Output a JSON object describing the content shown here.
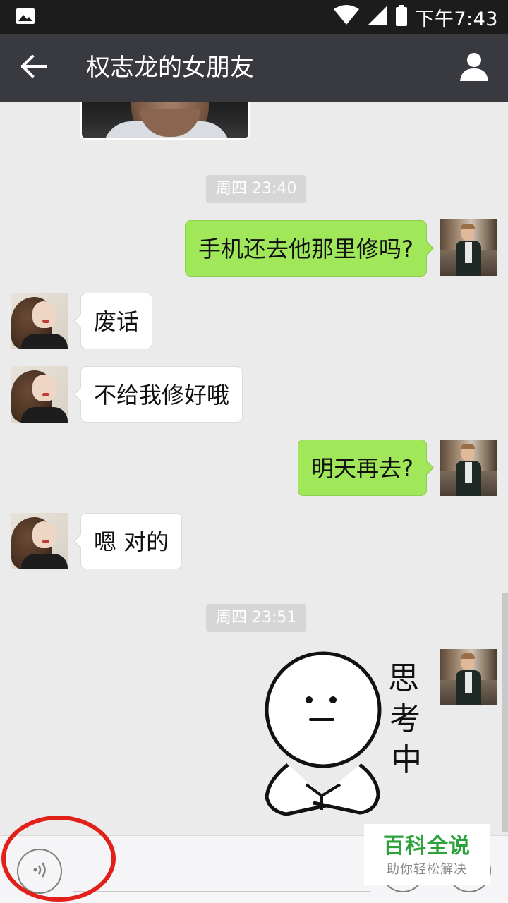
{
  "status_bar": {
    "time": "下午7:43",
    "left_icon": "image-icon",
    "right_icons": [
      "wifi-icon",
      "signal-icon",
      "battery-icon"
    ]
  },
  "header": {
    "title": "权志龙的女朋友",
    "back_icon": "back-arrow-icon",
    "profile_icon": "person-icon"
  },
  "messages": [
    {
      "type": "image",
      "from": "her"
    },
    {
      "type": "timestamp",
      "text": "周四 23:40"
    },
    {
      "type": "text",
      "from": "me",
      "text": "手机还去他那里修吗?"
    },
    {
      "type": "text",
      "from": "her",
      "text": "废话"
    },
    {
      "type": "text",
      "from": "her",
      "text": "不给我修好哦"
    },
    {
      "type": "text",
      "from": "me",
      "text": "明天再去?"
    },
    {
      "type": "text",
      "from": "her",
      "text": "嗯 对的"
    },
    {
      "type": "timestamp",
      "text": "周四 23:51"
    },
    {
      "type": "sticker",
      "from": "me",
      "text": "思考中"
    }
  ],
  "input_bar": {
    "voice_icon": "voice-icon",
    "emoji_icon": "emoji-icon",
    "plus_icon": "plus-icon"
  },
  "watermark": {
    "main": "百科全说",
    "sub": "助你轻松解决"
  },
  "colors": {
    "titlebar": "#393a3f",
    "sent_bubble": "#a0e75a",
    "received_bubble": "#ffffff",
    "annotation_circle": "#e2201a",
    "watermark_green": "#2ba33a"
  }
}
